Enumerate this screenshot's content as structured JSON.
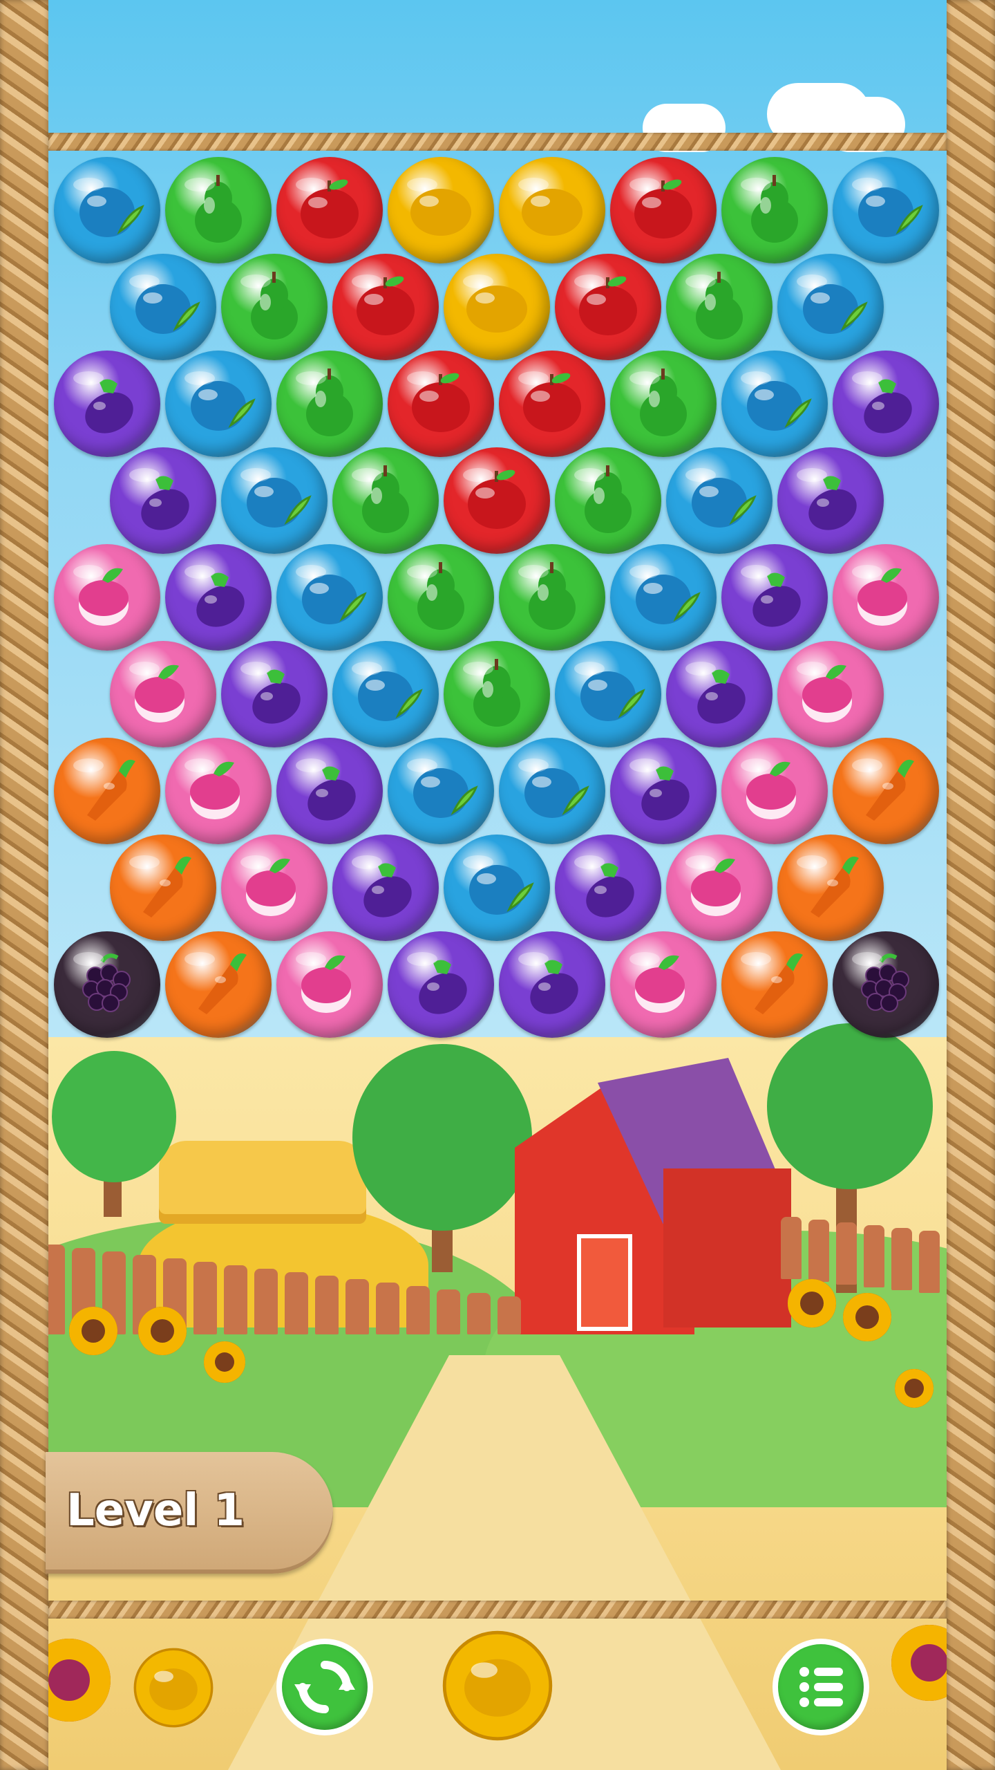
{
  "game": {
    "level_label": "Level 1"
  },
  "colors": {
    "blueberry": "#29a3e0",
    "pear": "#3cc23a",
    "apple": "#e3262a",
    "lemon": "#f3b800",
    "eggplant": "#7a3fd2",
    "radish": "#f06ab0",
    "carrot": "#f5741a",
    "blackberry": "#3a2a3a",
    "refresh_button": "#3fc23d",
    "menu_button": "#3fc23d"
  },
  "board": {
    "rows": [
      [
        "blueberry-icon",
        "pear-icon",
        "apple-icon",
        "lemon-icon",
        "lemon-icon",
        "apple-icon",
        "pear-icon",
        "blueberry-icon"
      ],
      [
        "blueberry-icon",
        "pear-icon",
        "apple-icon",
        "lemon-icon",
        "apple-icon",
        "pear-icon",
        "blueberry-icon"
      ],
      [
        "eggplant-icon",
        "blueberry-icon",
        "pear-icon",
        "apple-icon",
        "apple-icon",
        "pear-icon",
        "blueberry-icon",
        "eggplant-icon"
      ],
      [
        "eggplant-icon",
        "blueberry-icon",
        "pear-icon",
        "apple-icon",
        "pear-icon",
        "blueberry-icon",
        "eggplant-icon"
      ],
      [
        "radish-icon",
        "eggplant-icon",
        "blueberry-icon",
        "pear-icon",
        "pear-icon",
        "blueberry-icon",
        "eggplant-icon",
        "radish-icon"
      ],
      [
        "radish-icon",
        "eggplant-icon",
        "blueberry-icon",
        "pear-icon",
        "blueberry-icon",
        "eggplant-icon",
        "radish-icon"
      ],
      [
        "carrot-icon",
        "radish-icon",
        "eggplant-icon",
        "blueberry-icon",
        "blueberry-icon",
        "eggplant-icon",
        "radish-icon",
        "carrot-icon"
      ],
      [
        "carrot-icon",
        "radish-icon",
        "eggplant-icon",
        "blueberry-icon",
        "eggplant-icon",
        "radish-icon",
        "carrot-icon"
      ],
      [
        "blackberry-icon",
        "carrot-icon",
        "radish-icon",
        "eggplant-icon",
        "eggplant-icon",
        "radish-icon",
        "carrot-icon",
        "blackberry-icon"
      ]
    ]
  },
  "controls": {
    "next_bubble": "lemon-icon",
    "current_bubble": "lemon-icon",
    "swap_icon": "refresh-icon",
    "menu_icon": "menu-list-icon"
  }
}
